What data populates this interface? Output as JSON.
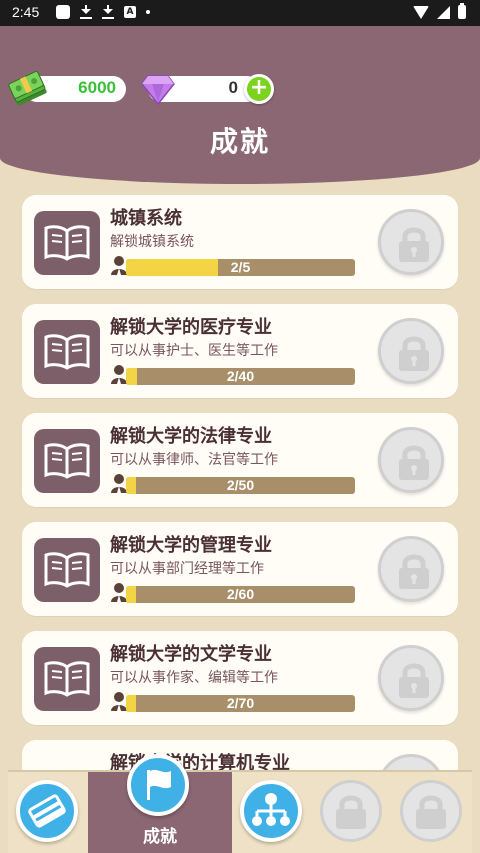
{
  "status_bar": {
    "time": "2:45",
    "icons": [
      "app-square-icon",
      "download-icon",
      "download-icon",
      "a-badge-icon",
      "dot-icon",
      "wifi-icon",
      "signal-icon",
      "battery-icon"
    ]
  },
  "header": {
    "cash": "6000",
    "gems": "0",
    "title": "成就"
  },
  "colors": {
    "header": "#8a6772",
    "background": "#e9dcc0",
    "progress_fill": "#f2d444",
    "progress_track": "#a88f6a",
    "nav_accent": "#3fb1e6"
  },
  "achievements": [
    {
      "title": "城镇系统",
      "subtitle": "解锁城镇系统",
      "progress": "2/5",
      "fraction": 0.4,
      "locked": true
    },
    {
      "title": "解锁大学的医疗专业",
      "subtitle": "可以从事护士、医生等工作",
      "progress": "2/40",
      "fraction": 0.05,
      "locked": true
    },
    {
      "title": "解锁大学的法律专业",
      "subtitle": "可以从事律师、法官等工作",
      "progress": "2/50",
      "fraction": 0.04,
      "locked": true
    },
    {
      "title": "解锁大学的管理专业",
      "subtitle": "可以从事部门经理等工作",
      "progress": "2/60",
      "fraction": 0.0333,
      "locked": true
    },
    {
      "title": "解锁大学的文学专业",
      "subtitle": "可以从事作家、编辑等工作",
      "progress": "2/70",
      "fraction": 0.0286,
      "locked": true
    },
    {
      "title": "解锁大学的计算机专业",
      "subtitle": "",
      "progress": "",
      "fraction": 0,
      "locked": true
    }
  ],
  "bottom_nav": {
    "items": [
      {
        "icon": "book-icon",
        "label": "",
        "active": false
      },
      {
        "icon": "flag-icon",
        "label": "成就",
        "active": true
      },
      {
        "icon": "org-chart-icon",
        "label": "",
        "active": false
      },
      {
        "icon": "lock-icon",
        "label": "",
        "active": false
      },
      {
        "icon": "lock-icon",
        "label": "",
        "active": false
      }
    ]
  }
}
